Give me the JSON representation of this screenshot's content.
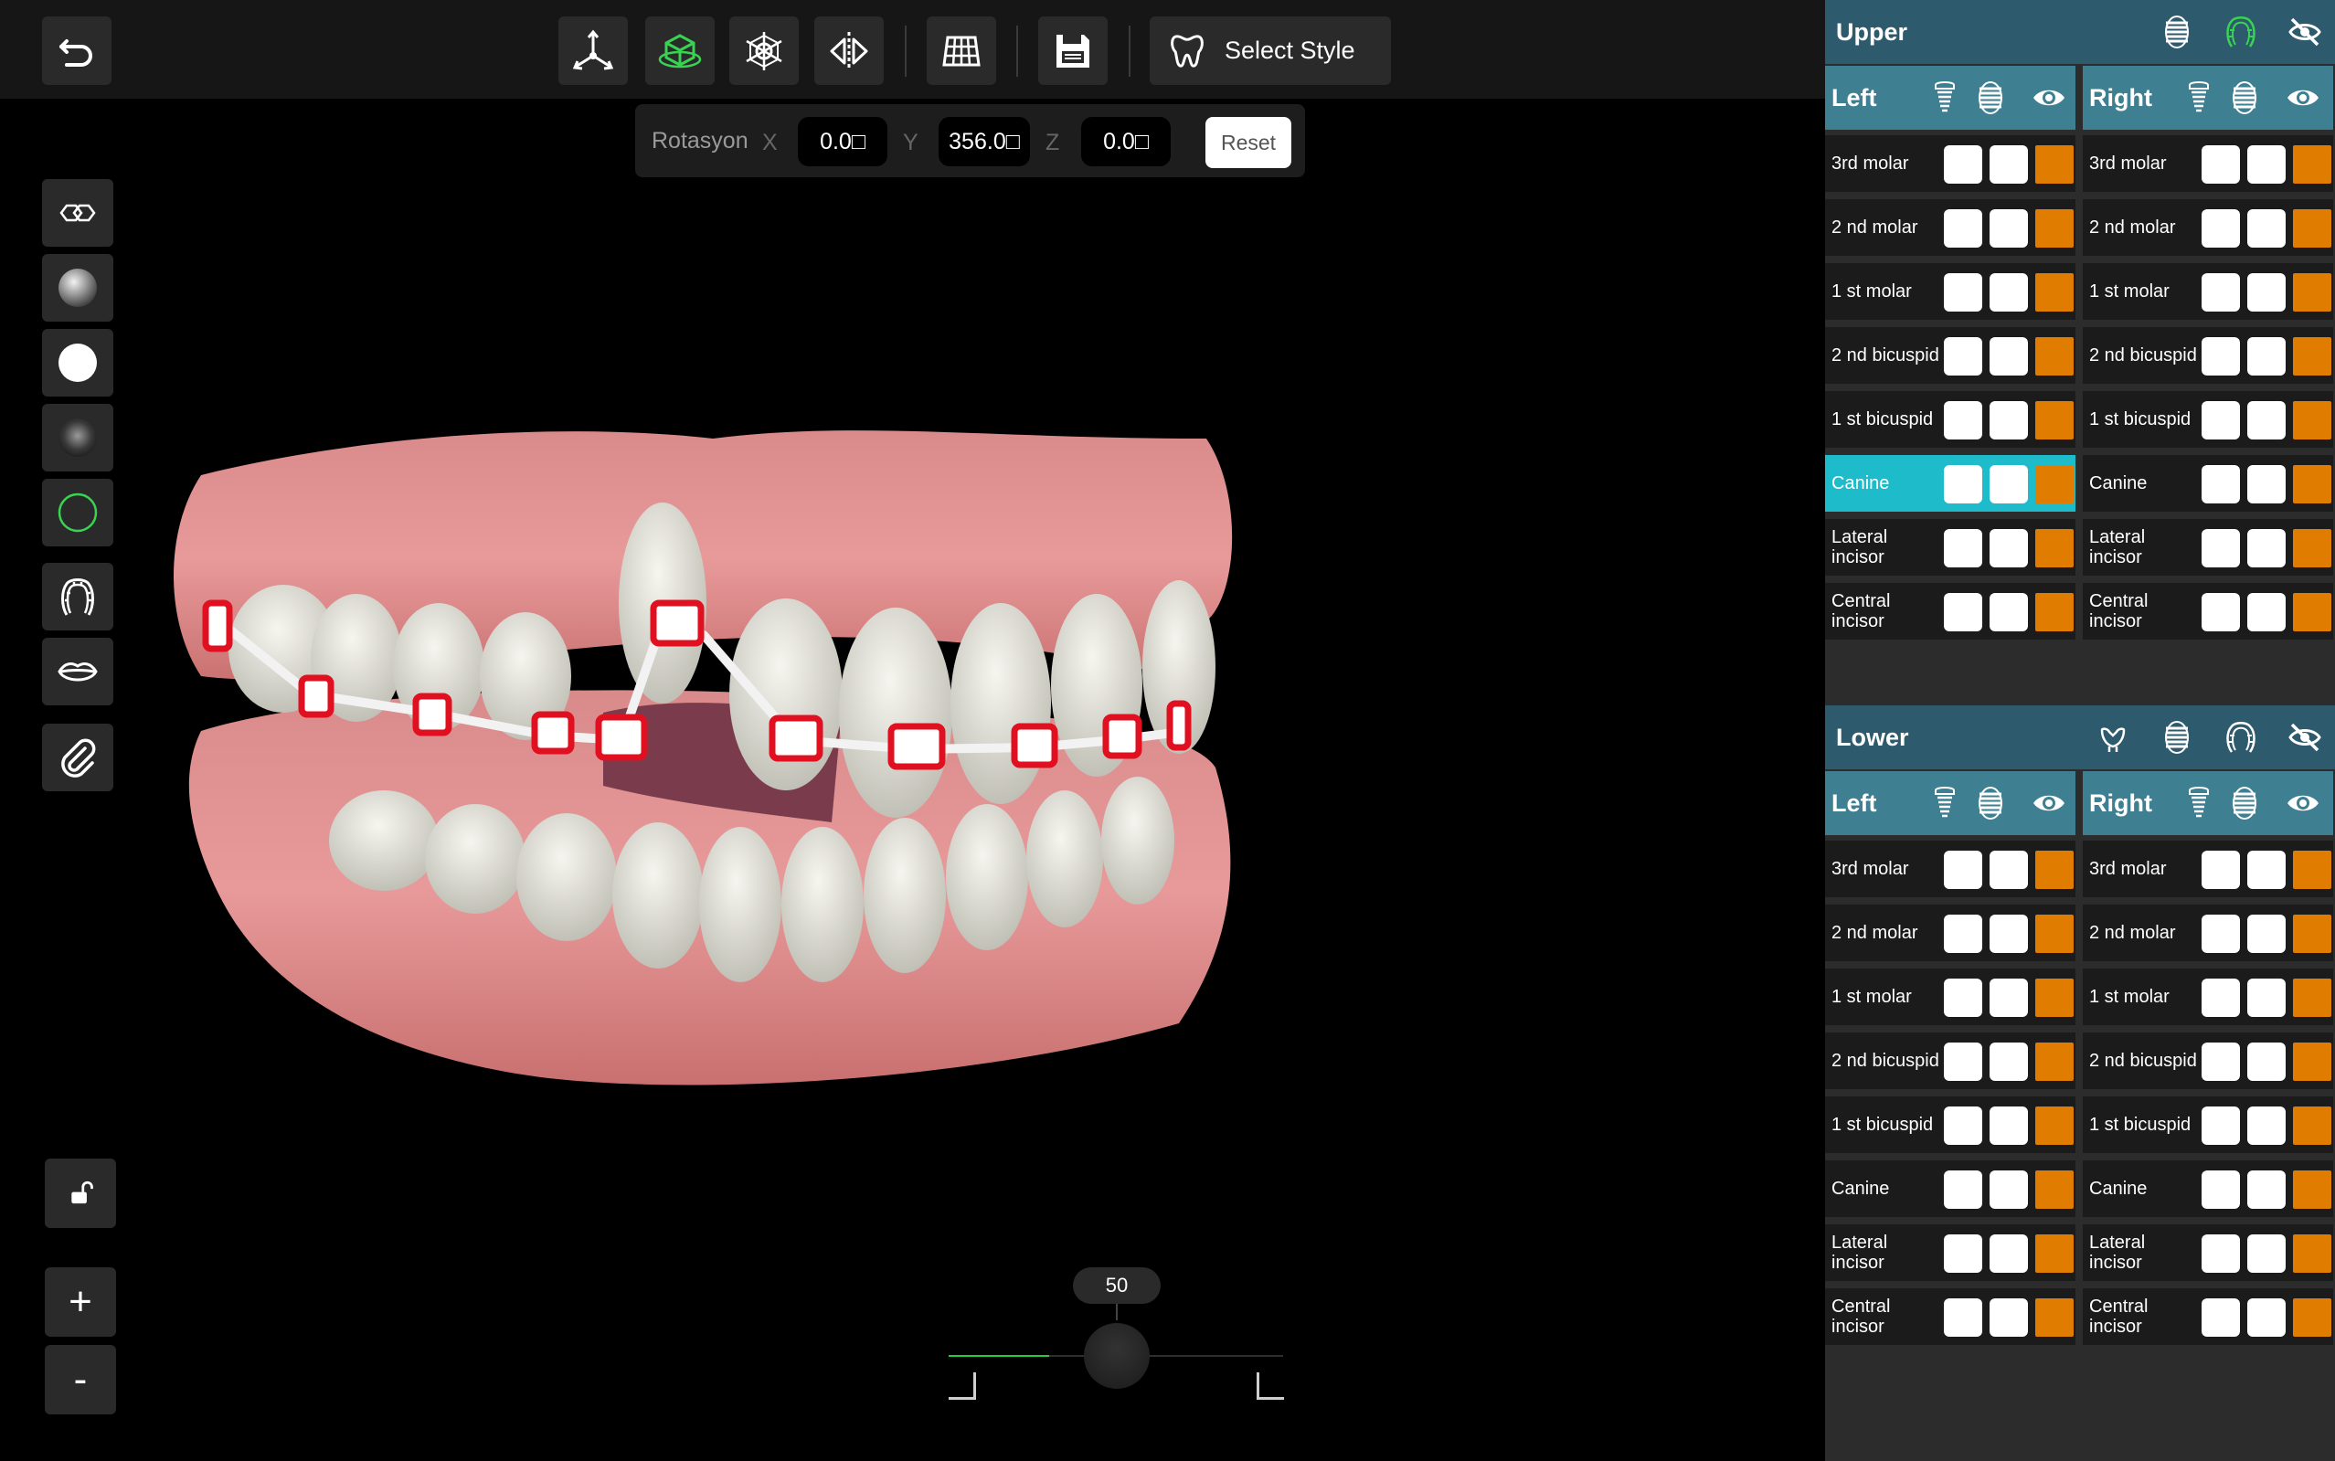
{
  "toolbar": {
    "icons": [
      "undo-icon",
      "move-axes-icon",
      "view-3d-icon",
      "wireframe-icon",
      "mirror-icon",
      "grid-icon",
      "save-icon",
      "tooth-icon"
    ],
    "select_style_label": "Select Style",
    "active_color": "#39d353"
  },
  "rotation": {
    "label": "Rotasyon",
    "x_label": "X",
    "x_value": "0.0□",
    "y_label": "Y",
    "y_value": "356.0□",
    "z_label": "Z",
    "z_value": "0.0□",
    "reset_label": "Reset"
  },
  "left_tools": {
    "icons": [
      "toggle-view-icon",
      "gray-sphere-icon",
      "white-sphere-icon",
      "dark-sphere-icon",
      "outline-sphere-icon",
      "teeth-arch-icon",
      "lips-icon",
      "paperclip-icon",
      "lock-open-icon"
    ],
    "zoom_in_label": "+",
    "zoom_out_label": "-"
  },
  "slider": {
    "value_label": "50",
    "value": 50,
    "min": 0,
    "max": 100
  },
  "upper": {
    "title": "Upper",
    "left": {
      "title": "Left",
      "teeth": [
        "3rd molar",
        "2 nd  molar",
        "1 st molar",
        "2 nd bicuspid",
        "1 st bicuspid",
        "Canine",
        "Lateral incisor",
        "Central incisor"
      ],
      "selected_index": 5
    },
    "right": {
      "title": "Right",
      "teeth": [
        "3rd molar",
        "2 nd  molar",
        "1 st molar",
        "2 nd bicuspid",
        "1 st bicuspid",
        "Canine",
        "Lateral incisor",
        "Central incisor"
      ]
    }
  },
  "lower": {
    "title": "Lower",
    "left": {
      "title": "Left",
      "teeth": [
        "3rd molar",
        "2 nd  molar",
        "1 st molar",
        "2 nd bicuspid",
        "1 st bicuspid",
        "Canine",
        "Lateral incisor",
        "Central incisor"
      ]
    },
    "right": {
      "title": "Right",
      "teeth": [
        "3rd molar",
        "2 nd  molar",
        "1 st molar",
        "2 nd bicuspid",
        "1 st bicuspid",
        "Canine",
        "Lateral incisor",
        "Central incisor"
      ]
    }
  },
  "colors": {
    "panel_header": "#2e5a6e",
    "side_header": "#3f7f92",
    "selected_row": "#1ebccb",
    "color_swatch": "#e07c00",
    "bracket_red": "#e01020"
  }
}
